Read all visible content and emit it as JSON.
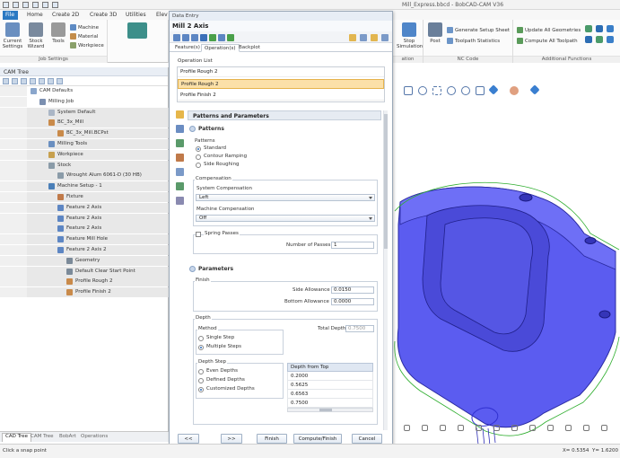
{
  "window": {
    "title": "Mill_Express.bbcd - BobCAD-CAM V36"
  },
  "ribbon": {
    "tabs": [
      "File",
      "Home",
      "Create 2D",
      "Create 3D",
      "Utilities",
      "Elev"
    ],
    "groups": {
      "job_settings": {
        "label": "Job Settings",
        "buttons": [
          {
            "label": "Current\nSettings",
            "icon": "settings-icon"
          },
          {
            "label": "Stock\nWizard",
            "icon": "stock-icon"
          },
          {
            "label": "Tools",
            "icon": "tools-icon"
          }
        ],
        "small": [
          "Machine",
          "Material",
          "Workpiece"
        ]
      },
      "simulation": {
        "label": "ation",
        "button": "Stop\nSimulation"
      },
      "nc_code": {
        "label": "NC Code",
        "button": "Post",
        "items": [
          "Generate Setup Sheet",
          "Toolpath Statistics"
        ]
      },
      "additional": {
        "label": "Additional Functions",
        "items": [
          "Update All Geometries",
          "Compute All Toolpath"
        ]
      }
    }
  },
  "cam_tree": {
    "title": "CAM Tree",
    "items": [
      {
        "label": "CAM Defaults",
        "indent": 0
      },
      {
        "label": "Milling Job",
        "indent": 1
      },
      {
        "label": "System Default",
        "indent": 2
      },
      {
        "label": "BC_3x_Mill",
        "indent": 2
      },
      {
        "label": "BC_3x_Mill.BCPst",
        "indent": 3
      },
      {
        "label": "Milling Tools",
        "indent": 2
      },
      {
        "label": "Workpiece",
        "indent": 2
      },
      {
        "label": "Stock",
        "indent": 2
      },
      {
        "label": "Wrought Alum 6061-D (30 HB)",
        "indent": 3
      },
      {
        "label": "Machine Setup - 1",
        "indent": 2
      },
      {
        "label": "Fixture",
        "indent": 3
      },
      {
        "label": "Feature 2 Axis",
        "indent": 3
      },
      {
        "label": "Feature 2 Axis",
        "indent": 3
      },
      {
        "label": "Feature 2 Axis",
        "indent": 3
      },
      {
        "label": "Feature Mill Hole",
        "indent": 3
      },
      {
        "label": "Feature 2 Axis 2",
        "indent": 3
      },
      {
        "label": "Geometry",
        "indent": 4
      },
      {
        "label": "Default Clear Start Point",
        "indent": 4
      },
      {
        "label": "Profile Rough 2",
        "indent": 4
      },
      {
        "label": "Profile Finish 2",
        "indent": 4
      }
    ],
    "bottom_tabs": [
      "CAD Tree",
      "CAM Tree",
      "BobArt",
      "Operations"
    ]
  },
  "dialog": {
    "title": "Data Entry",
    "name": "Mill 2 Axis",
    "tabs": [
      "Feature(s)",
      "Operation(s)",
      "Backplot"
    ],
    "operation_list_label": "Operation List",
    "operations": [
      "Profile Rough 2",
      "Profile Rough 2",
      "Profile Finish 2"
    ],
    "section_title": "Patterns and Parameters",
    "patterns": {
      "header": "Patterns",
      "group": "Patterns",
      "options": [
        "Standard",
        "Contour Ramping",
        "Side Roughing"
      ],
      "selected": 0
    },
    "compensation": {
      "group": "Compensation",
      "system_label": "System Compensation",
      "system_value": "Left",
      "machine_label": "Machine Compensation",
      "machine_value": "Off"
    },
    "spring_passes": {
      "label": "Spring Passes",
      "count_label": "Number of Passes",
      "count": "1"
    },
    "parameters": {
      "header": "Parameters",
      "finish_group": "Finish",
      "side_allowance_label": "Side Allowance",
      "side_allowance": "0.0150",
      "bottom_allowance_label": "Bottom Allowance",
      "bottom_allowance": "0.0000"
    },
    "depth": {
      "group": "Depth",
      "method_group": "Method",
      "methods": [
        "Single Step",
        "Multiple Steps"
      ],
      "method_selected": 1,
      "total_depth_label": "Total Depth",
      "total_depth": "0.7500",
      "depth_step_group": "Depth Step",
      "depth_step_options": [
        "Even Depths",
        "Defined Depths",
        "Customized Depths"
      ],
      "depth_step_selected": 2,
      "table_header": "Depth from Top",
      "table_values": [
        "0.2000",
        "0.5625",
        "0.6563",
        "0.7500"
      ]
    },
    "buttons": {
      "prev": "<<",
      "next": ">>",
      "finish": "Finish",
      "compute_finish": "Compute/Finish",
      "cancel": "Cancel"
    }
  },
  "status": {
    "prompt": "Click a snap point",
    "x": "X= 0.5354",
    "y": "Y= 1.6200"
  },
  "colors": {
    "accent": "#2b79c2",
    "model": "#5b5cf0",
    "selection": "#fbe0a8"
  }
}
